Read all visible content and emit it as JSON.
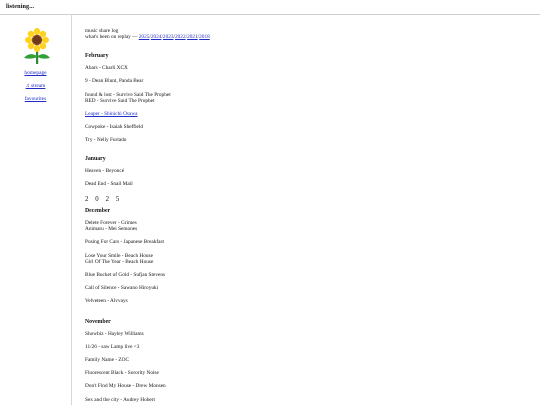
{
  "topbar": {
    "title": "listening..."
  },
  "sidebar": {
    "logo_icon": "sunflower-icon",
    "links": [
      "homepage",
      "♫ stream",
      "favourites"
    ]
  },
  "header": {
    "line1": "music share log",
    "line2_prefix": "what's been on replay — ",
    "years": [
      "2025",
      "2024",
      "2023",
      "2022",
      "2021",
      "2018"
    ]
  },
  "months": {
    "feb": {
      "title": "February",
      "entries": [
        [
          "Abars - Charli XCX"
        ],
        [
          "9 - Dean Blunt, Panda Bear"
        ],
        [
          "found & lost - Survive Said The Prophet",
          "RED - Survive Said The Prophet"
        ],
        [
          "Leaper - Shinichi Osawa"
        ],
        [
          "Cowpoke - Isaiah Sheffield"
        ],
        [
          "Try - Nelly Furtado"
        ]
      ]
    },
    "jan": {
      "title": "January",
      "entries": [
        [
          "Heaven - Beyoncé"
        ],
        [
          "Dead End - Snail Mail"
        ]
      ]
    },
    "year_break": "2 0 2 5",
    "dec": {
      "title": "December",
      "entries": [
        [
          "Delete Forever - Grimes",
          "Animaru - Mei Semones"
        ],
        [
          "Posing For Cars - Japanese Breakfast"
        ],
        [
          "Lose Your Smile - Beach House",
          "Girl Of The Year - Beach House"
        ],
        [
          "Blue Bucket of Gold - Sufjan Stevens"
        ],
        [
          "Call of Silence - Sawano Hiroyuki"
        ],
        [
          "Velveteen - Alvvays"
        ]
      ]
    },
    "nov": {
      "title": "November",
      "entries": [
        [
          "Showbiz - Hayley Williams"
        ],
        [
          "11/26 - saw Lamp live <3"
        ],
        [
          "Family Name - ZOC"
        ],
        [
          "Fluorescent Black - Sorority Noise"
        ],
        [
          "Don't Find My House - Drew Monsen"
        ],
        [
          "Sex and the city - Audrey Hobert"
        ]
      ]
    }
  },
  "colors": {
    "link": "#1f2cc7",
    "divider": "#d7d7d7"
  }
}
